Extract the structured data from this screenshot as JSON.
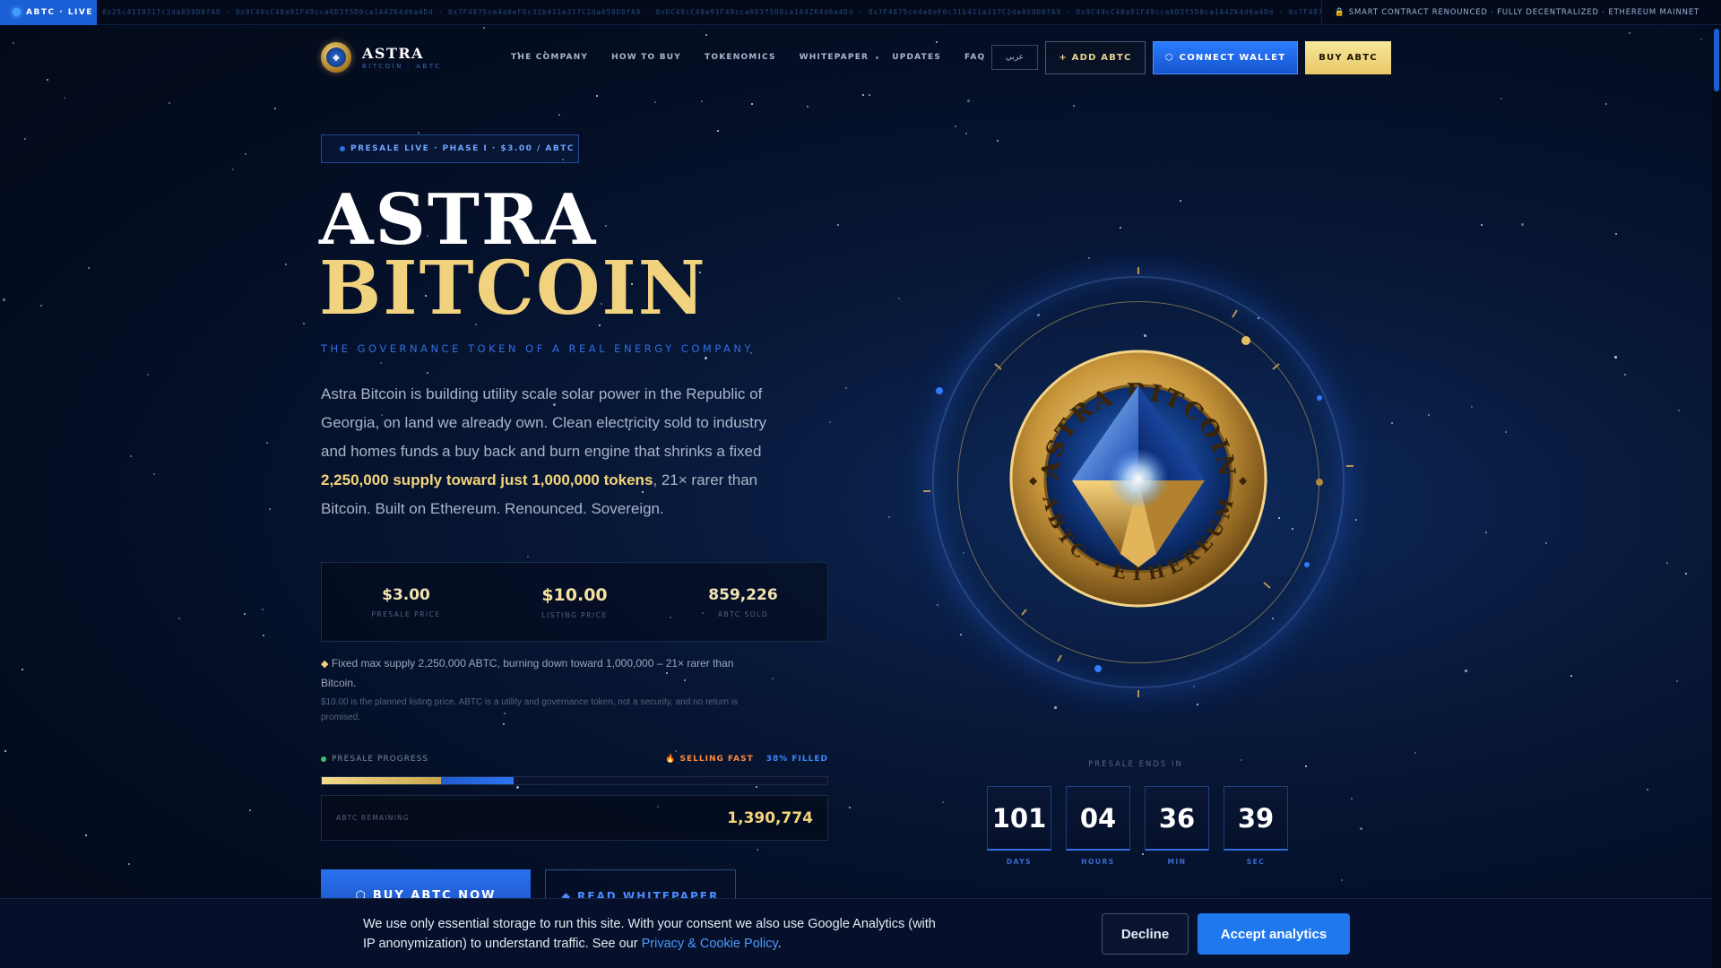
{
  "ticker": {
    "live_label": "ABTC · LIVE",
    "addresses": "0x25c4119317c2da059D0fA9 · 0x9C49cC48a91F49cca6D3f5D0ca1A4ZK4d6a4Dd · 0x7F4875ce4a0eF0c31b411a317C2da059D0fA9 · 0xDC49cC48a91F49cca6D3f5D0ca1A4ZK4d6a4Dd · 0x7F4875ce4a0eF0c31b411a317C2da059D0fA9 · 0x9C49cC48a91F49cca6D3f5D0ca1A4ZK4d6a4Dd · 0x7F4875ce4a0eF0c31b411a317C2da059D0fA9",
    "right_text": "SMART CONTRACT RENOUNCED · FULLY DECENTRALIZED · ETHEREUM MAINNET"
  },
  "nav": {
    "brand": "ASTRA",
    "brand_sub": "BITCOIN · ABTC",
    "links": [
      "THE COMPANY",
      "HOW TO BUY",
      "TOKENOMICS",
      "WHITEPAPER",
      "UPDATES",
      "FAQ"
    ],
    "lang": "عربي",
    "add_label": "+ ADD ABTC",
    "connect_label": "CONNECT WALLET",
    "buy_label": "BUY ABTC"
  },
  "hero": {
    "tag": "PRESALE LIVE · PHASE I · $3.00 / ABTC",
    "title_line1": "ASTRA",
    "title_line2": "BITCOIN",
    "tagline": "THE GOVERNANCE TOKEN OF A REAL ENERGY COMPANY",
    "desc_before": "Astra Bitcoin is building utility scale solar power in the Republic of Georgia, on land we already own. Clean electricity sold to industry and homes funds a buy back and burn engine that shrinks a fixed ",
    "desc_strong": "2,250,000 supply toward just 1,000,000 tokens",
    "desc_after": ", 21× rarer than Bitcoin. Built on Ethereum. Renounced. Sovereign."
  },
  "stats": [
    {
      "value": "$3.00",
      "label": "PRESALE PRICE"
    },
    {
      "value": "$10.00",
      "label": "LISTING PRICE"
    },
    {
      "value": "859,226",
      "label": "ABTC SOLD"
    }
  ],
  "supply_note": "Fixed max supply 2,250,000 ABTC, burning down toward 1,000,000 – 21× rarer than Bitcoin.",
  "disclaimer": "$10.00 is the planned listing price. ABTC is a utility and governance token, not a security, and no return is promised.",
  "progress": {
    "label": "PRESALE PROGRESS",
    "selling": "🔥 SELLING FAST",
    "filled_label": "38% FILLED",
    "gold_fraction": 0.235,
    "filled_fraction": 0.38,
    "remaining_label": "ABTC REMAINING",
    "remaining_value": "1,390,774"
  },
  "cta": {
    "buy": "BUY ABTC NOW",
    "read": "READ WHITEPAPER"
  },
  "coin": {
    "top_text": "ASTRA BITCOIN",
    "bottom_text": "ABTC · ETHEREUM"
  },
  "countdown": {
    "label": "PRESALE ENDS IN",
    "items": [
      {
        "value": "101",
        "unit": "DAYS"
      },
      {
        "value": "04",
        "unit": "HOURS"
      },
      {
        "value": "36",
        "unit": "MIN"
      },
      {
        "value": "39",
        "unit": "SEC"
      }
    ]
  },
  "cookie": {
    "text": "We use only essential storage to run this site. With your consent we also use Google Analytics (with IP anonymization) to understand traffic. See our ",
    "link": "Privacy & Cookie Policy",
    "end": ".",
    "decline": "Decline",
    "accept": "Accept analytics"
  },
  "colors": {
    "accent_blue": "#1f78ee",
    "gold": "#f1d27e",
    "background": "#040d22"
  }
}
